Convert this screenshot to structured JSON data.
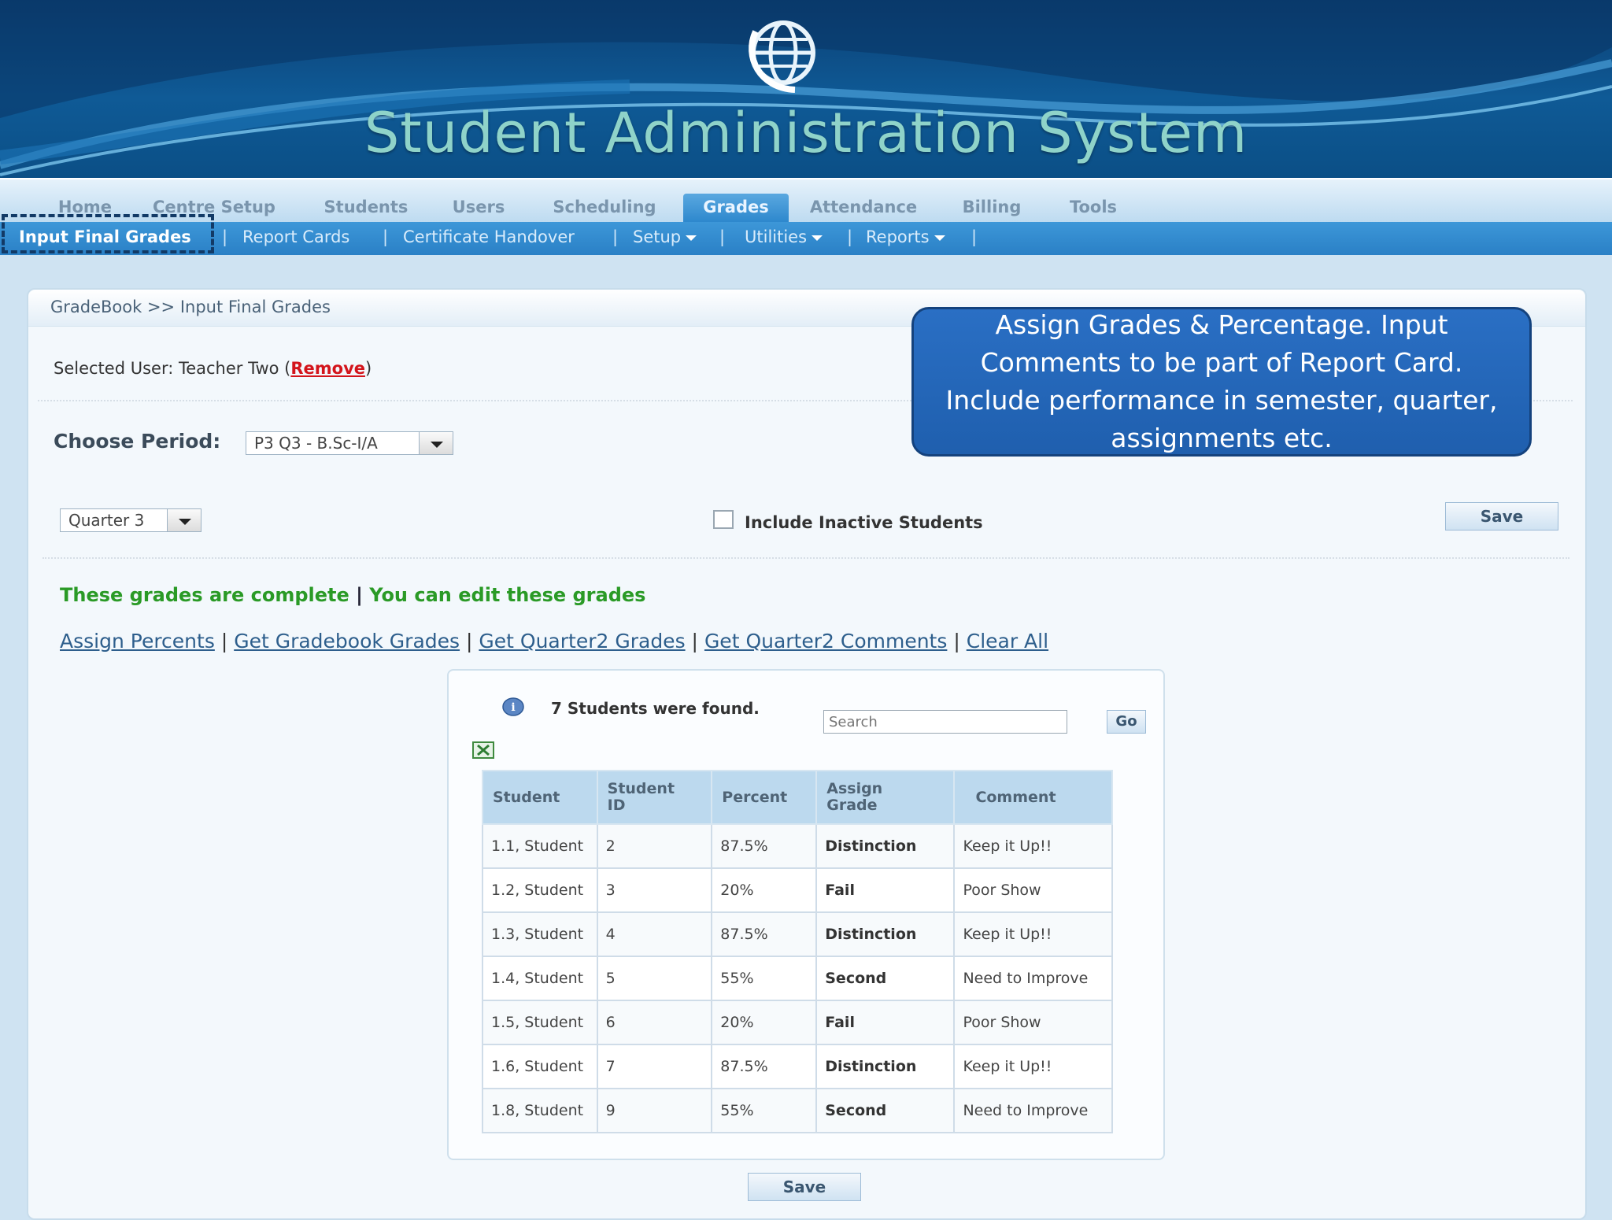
{
  "header": {
    "title": "Student Administration System",
    "logo_icon": "globe-logo-icon"
  },
  "main_nav": {
    "tabs": [
      "Home",
      "Centre Setup",
      "Students",
      "Users",
      "Scheduling",
      "Grades",
      "Attendance",
      "Billing",
      "Tools"
    ],
    "active": "Grades"
  },
  "sub_nav": {
    "items": [
      "Input Final Grades",
      "Report Cards",
      "Certificate Handover",
      "Setup",
      "Utilities",
      "Reports"
    ],
    "active": "Input Final Grades"
  },
  "breadcrumb": "GradeBook >> Input Final Grades",
  "selected_user": {
    "prefix": "Selected User: Teacher Two (",
    "remove_link": "Remove",
    "suffix": ")"
  },
  "period": {
    "label": "Choose Period:",
    "selected": "P3 Q3 - B.Sc-I/A"
  },
  "quarter": {
    "selected": "Quarter 3"
  },
  "include_inactive": {
    "label": "Include Inactive Students",
    "checked": false
  },
  "save_label": "Save",
  "status": {
    "complete": "These grades are complete",
    "separator": "|",
    "editable": "You can edit these grades"
  },
  "action_links": [
    "Assign Percents",
    "Get Gradebook Grades",
    "Get Quarter2 Grades",
    "Get Quarter2 Comments",
    "Clear All"
  ],
  "grid": {
    "found_text": "7 Students were found.",
    "search_placeholder": "Search",
    "go_label": "Go",
    "columns": [
      {
        "line1": "Student",
        "line2": ""
      },
      {
        "line1": "Student",
        "line2": "ID"
      },
      {
        "line1": "Percent",
        "line2": ""
      },
      {
        "line1": "Assign",
        "line2": "Grade"
      },
      {
        "line1": "Comment",
        "line2": ""
      }
    ],
    "rows": [
      {
        "student": "1.1, Student",
        "id": "2",
        "percent": "87.5%",
        "grade": "Distinction",
        "comment": "Keep it Up!!"
      },
      {
        "student": "1.2, Student",
        "id": "3",
        "percent": "20%",
        "grade": "Fail",
        "comment": "Poor Show"
      },
      {
        "student": "1.3, Student",
        "id": "4",
        "percent": "87.5%",
        "grade": "Distinction",
        "comment": "Keep it Up!!"
      },
      {
        "student": "1.4, Student",
        "id": "5",
        "percent": "55%",
        "grade": "Second",
        "comment": "Need to Improve"
      },
      {
        "student": "1.5, Student",
        "id": "6",
        "percent": "20%",
        "grade": "Fail",
        "comment": "Poor Show"
      },
      {
        "student": "1.6, Student",
        "id": "7",
        "percent": "87.5%",
        "grade": "Distinction",
        "comment": "Keep it Up!!"
      },
      {
        "student": "1.8, Student",
        "id": "9",
        "percent": "55%",
        "grade": "Second",
        "comment": "Need to Improve"
      }
    ]
  },
  "callout": "Assign Grades & Percentage.  Input Comments to be part of Report Card. Include performance in semester, quarter, assignments etc.",
  "colors": {
    "banner": "#0f5a96",
    "title_text": "#8fd3c9",
    "status_green": "#2a9a26",
    "remove_red": "#d3141b",
    "callout_blue": "#2a6fc4"
  }
}
